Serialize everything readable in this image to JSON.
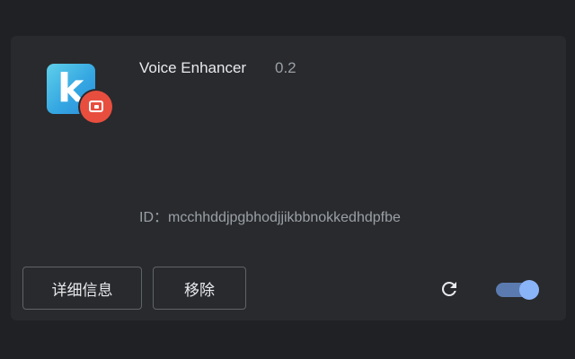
{
  "extension": {
    "name": "Voice Enhancer",
    "version": "0.2",
    "id_label": "ID：",
    "id_value": "mcchhddjpgbhodjjikbbnokkedhdpfbe",
    "icon": "k-letter-app-icon",
    "badge_icon": "camera-icon",
    "enabled": true
  },
  "actions": {
    "details_label": "详细信息",
    "remove_label": "移除",
    "reload_icon": "reload-icon",
    "toggle_icon": "toggle-switch"
  },
  "colors": {
    "page_bg": "#202124",
    "card_bg": "#292a2d",
    "text_primary": "#e8eaed",
    "text_secondary": "#9aa0a6",
    "accent": "#8ab4f8",
    "badge": "#e84e3e"
  }
}
